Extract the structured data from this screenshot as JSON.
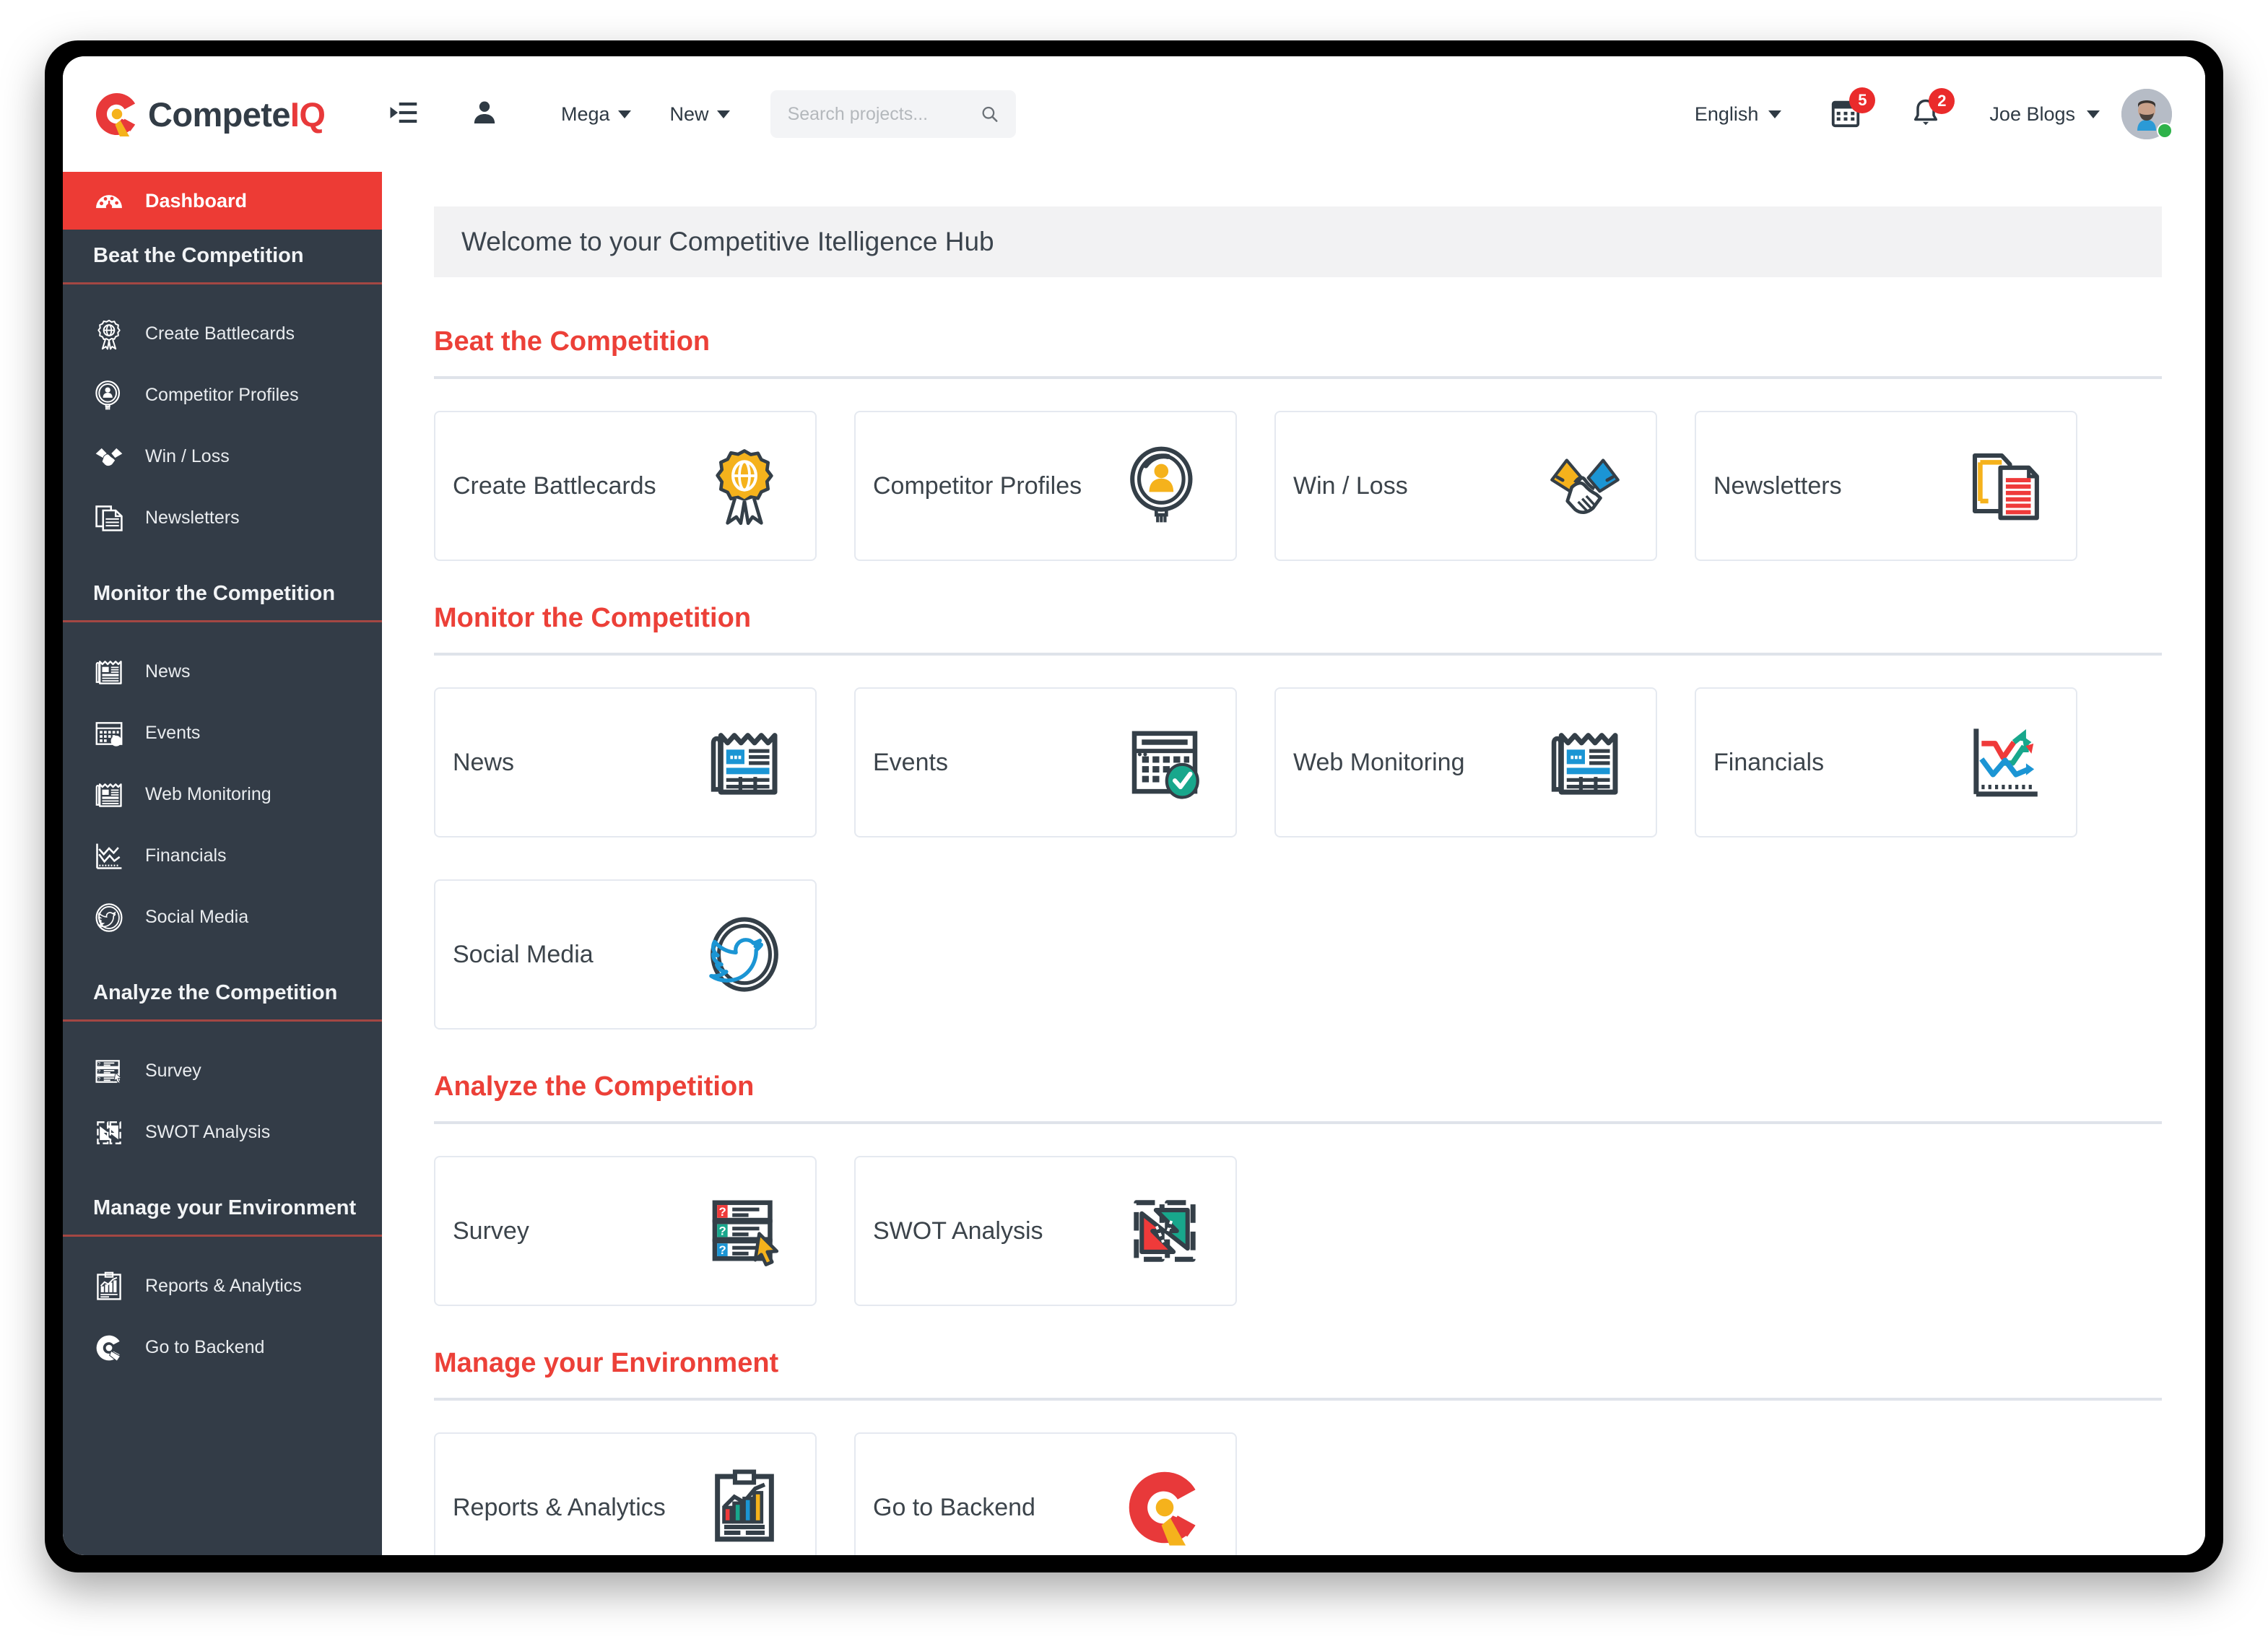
{
  "brand": {
    "name_prefix": "Compete",
    "name_suffix": "IQ"
  },
  "header": {
    "collapse_icon": "collapse-menu-icon",
    "person_icon": "person-icon",
    "menu": [
      {
        "label": "Mega",
        "icon": "chevron-down-icon"
      },
      {
        "label": "New",
        "icon": "chevron-down-icon"
      }
    ],
    "search": {
      "placeholder": "Search projects...",
      "value": "",
      "icon": "search-icon"
    },
    "language": {
      "label": "English",
      "icon": "chevron-down-icon"
    },
    "calendar": {
      "icon": "calendar-icon",
      "badge": "5"
    },
    "notifications": {
      "icon": "bell-icon",
      "badge": "2"
    },
    "user": {
      "name": "Joe Blogs",
      "icon": "chevron-down-icon",
      "avatar": "user-avatar",
      "status": "online"
    }
  },
  "sidebar": {
    "active_item": {
      "label": "Dashboard",
      "icon": "dashboard-gauge-icon"
    },
    "groups": [
      {
        "title": "Beat the Competition",
        "items": [
          {
            "label": "Create Battlecards",
            "icon": "ribbon-globe-icon"
          },
          {
            "label": "Competitor Profiles",
            "icon": "magnifier-person-icon"
          },
          {
            "label": "Win / Loss",
            "icon": "handshake-icon"
          },
          {
            "label": "Newsletters",
            "icon": "documents-icon"
          }
        ]
      },
      {
        "title": "Monitor the Competition",
        "items": [
          {
            "label": "News",
            "icon": "newspaper-icon"
          },
          {
            "label": "Events",
            "icon": "calendar-check-icon"
          },
          {
            "label": "Web Monitoring",
            "icon": "newspaper-icon"
          },
          {
            "label": "Financials",
            "icon": "line-chart-icon"
          },
          {
            "label": "Social Media",
            "icon": "twitter-bird-icon"
          }
        ]
      },
      {
        "title": "Analyze the Competition",
        "items": [
          {
            "label": "Survey",
            "icon": "survey-list-icon"
          },
          {
            "label": "SWOT Analysis",
            "icon": "swot-arrows-icon"
          }
        ]
      },
      {
        "title": "Manage your Environment",
        "items": [
          {
            "label": "Reports & Analytics",
            "icon": "clipboard-chart-icon"
          },
          {
            "label": "Go to Backend",
            "icon": "competeiq-logo-icon"
          }
        ]
      }
    ]
  },
  "main": {
    "welcome": "Welcome to your Competitive Itelligence Hub",
    "sections": [
      {
        "title": "Beat the Competition",
        "cards": [
          {
            "label": "Create Battlecards",
            "icon": "ribbon-globe-icon"
          },
          {
            "label": "Competitor Profiles",
            "icon": "magnifier-person-icon"
          },
          {
            "label": "Win / Loss",
            "icon": "handshake-icon"
          },
          {
            "label": "Newsletters",
            "icon": "documents-icon"
          }
        ]
      },
      {
        "title": "Monitor the Competition",
        "cards": [
          {
            "label": "News",
            "icon": "newspaper-icon"
          },
          {
            "label": "Events",
            "icon": "calendar-check-icon"
          },
          {
            "label": "Web Monitoring",
            "icon": "newspaper-icon"
          },
          {
            "label": "Financials",
            "icon": "line-chart-icon"
          },
          {
            "label": "Social Media",
            "icon": "twitter-bird-icon"
          }
        ]
      },
      {
        "title": "Analyze the Competition",
        "cards": [
          {
            "label": "Survey",
            "icon": "survey-list-icon"
          },
          {
            "label": "SWOT Analysis",
            "icon": "swot-arrows-icon"
          }
        ]
      },
      {
        "title": "Manage your Environment",
        "cards": [
          {
            "label": "Reports & Analytics",
            "icon": "clipboard-chart-icon"
          },
          {
            "label": "Go to Backend",
            "icon": "competeiq-logo-icon"
          }
        ]
      }
    ]
  },
  "colors": {
    "accent_red": "#ed3b35",
    "section_heading_red": "#ec4038",
    "sidebar_dark": "#333c47",
    "badge_red": "#ea2b2b",
    "online_green": "#2eb24a",
    "icon_yellow": "#f5b21c",
    "icon_blue": "#1b95d4",
    "icon_teal": "#18a78c"
  }
}
